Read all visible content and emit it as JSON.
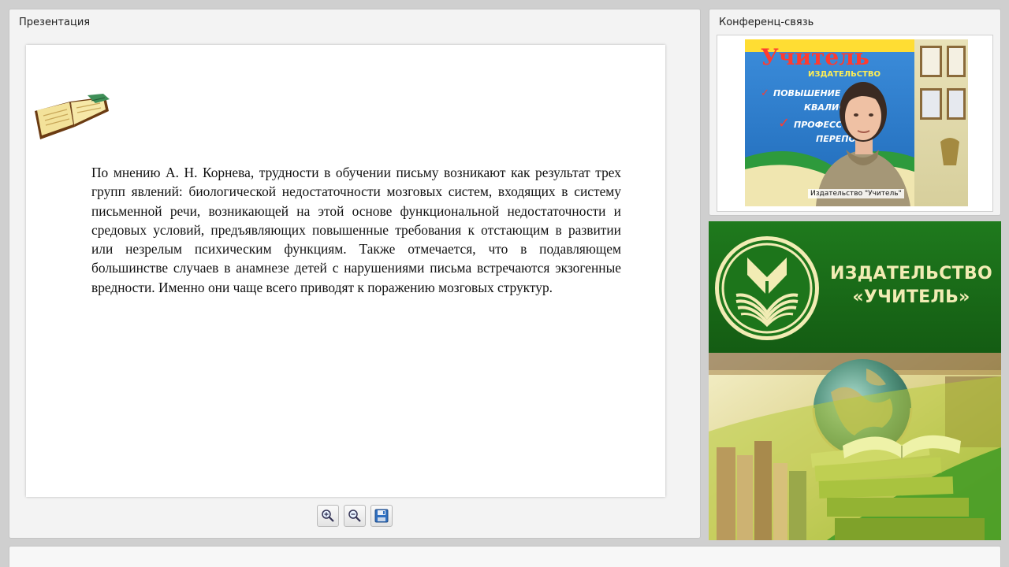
{
  "presentation": {
    "title": "Презентация",
    "slide_text": "По мнению А. Н. Корнева, трудности в обучении письму возникают как результат трех групп явлений: биологической недостаточности мозговых систем, входящих в систему письменной речи, возникающей на этой основе функциональной недостаточности и средовых условий, предъявляющих повышенные требования к отстающим в развитии или незрелым психическим функциям. Также отмечается, что в подавляющем большинстве случаев в анамнезе детей с нарушениями письма встречаются экзогенные вредности. Именно они чаще всего приводят к поражению мозговых структур.",
    "toolbar": {
      "icons": [
        "zoom-in-icon",
        "zoom-out-icon",
        "save-icon"
      ]
    }
  },
  "conference": {
    "title": "Конференц-связь",
    "video_label": "Издательство \"Учитель\"",
    "background_sign": {
      "line1": "Учитель",
      "line2": "ИЗДАТЕЛЬСТВО",
      "line3": "ПОВЫШЕНИЕ",
      "line4": "КВАЛИФИ",
      "line5": "ПРОФЕСС",
      "line6": "ПЕРЕПОД"
    }
  },
  "banner": {
    "publisher_line1": "ИЗДАТЕЛЬСТВО",
    "publisher_line2": "«УЧИТЕЛЬ»"
  },
  "colors": {
    "banner_green": "#1a6e18",
    "banner_text": "#f2ecb4",
    "panel_bg": "#f3f3f3"
  }
}
